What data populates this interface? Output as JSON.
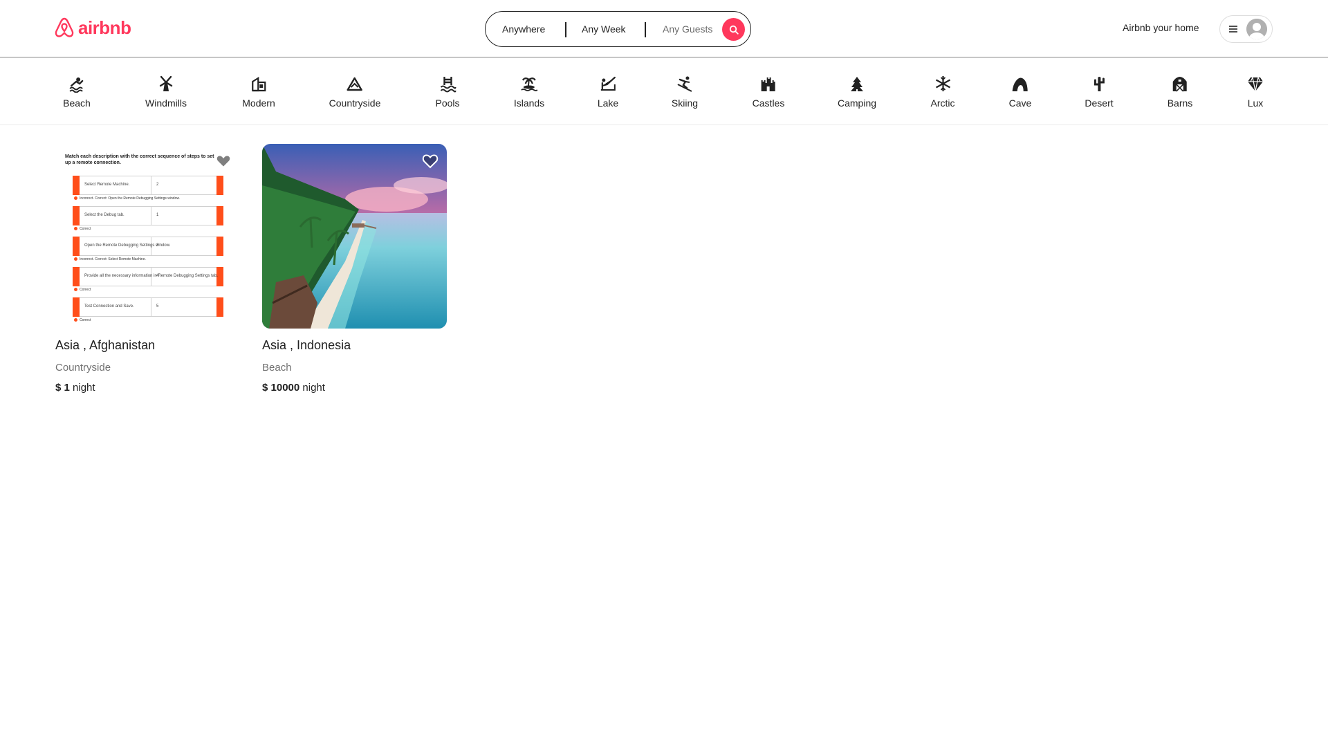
{
  "brand": {
    "name": "airbnb",
    "color": "#ff385c"
  },
  "search": {
    "where": "Anywhere",
    "when": "Any Week",
    "who": "Any Guests",
    "icon": "search-icon"
  },
  "header": {
    "host_link": "Airbnb your home",
    "menu_icon": "hamburger-icon",
    "avatar_icon": "user-avatar-icon"
  },
  "categories": [
    {
      "label": "Beach",
      "icon": "beach-icon"
    },
    {
      "label": "Windmills",
      "icon": "windmill-icon"
    },
    {
      "label": "Modern",
      "icon": "modern-house-icon"
    },
    {
      "label": "Countryside",
      "icon": "mountain-icon"
    },
    {
      "label": "Pools",
      "icon": "pool-icon"
    },
    {
      "label": "Islands",
      "icon": "island-icon"
    },
    {
      "label": "Lake",
      "icon": "lake-icon"
    },
    {
      "label": "Skiing",
      "icon": "skiing-icon"
    },
    {
      "label": "Castles",
      "icon": "castle-icon"
    },
    {
      "label": "Camping",
      "icon": "camping-icon"
    },
    {
      "label": "Arctic",
      "icon": "snowflake-icon"
    },
    {
      "label": "Cave",
      "icon": "cave-icon"
    },
    {
      "label": "Desert",
      "icon": "cactus-icon"
    },
    {
      "label": "Barns",
      "icon": "barn-icon"
    },
    {
      "label": "Lux",
      "icon": "diamond-icon"
    }
  ],
  "listings": [
    {
      "title": "Asia , Afghanistan",
      "category": "Countryside",
      "currency": "$",
      "price": "1",
      "unit": "night",
      "favorite_icon": "heart-icon",
      "thumbnail": {
        "heading": "Match each description with the correct sequence of steps to set up a remote connection.",
        "rows": [
          {
            "text": "Select Remote Machine.",
            "num": "2",
            "note": "Incorrect. Correct: Open the Remote Debugging Settings window."
          },
          {
            "text": "Select the Debug tab.",
            "num": "1",
            "note": "Correct"
          },
          {
            "text": "Open the Remote Debugging Settings window.",
            "num": "3",
            "note": "Incorrect. Correct: Select Remote Machine."
          },
          {
            "text": "Provide all the necessary information in Remote Debugging Settings tab.",
            "num": "4",
            "note": "Correct"
          },
          {
            "text": "Test Connection and Save.",
            "num": "5",
            "note": "Correct"
          }
        ]
      }
    },
    {
      "title": "Asia , Indonesia",
      "category": "Beach",
      "currency": "$",
      "price": "10000",
      "unit": "night",
      "favorite_icon": "heart-icon"
    }
  ]
}
